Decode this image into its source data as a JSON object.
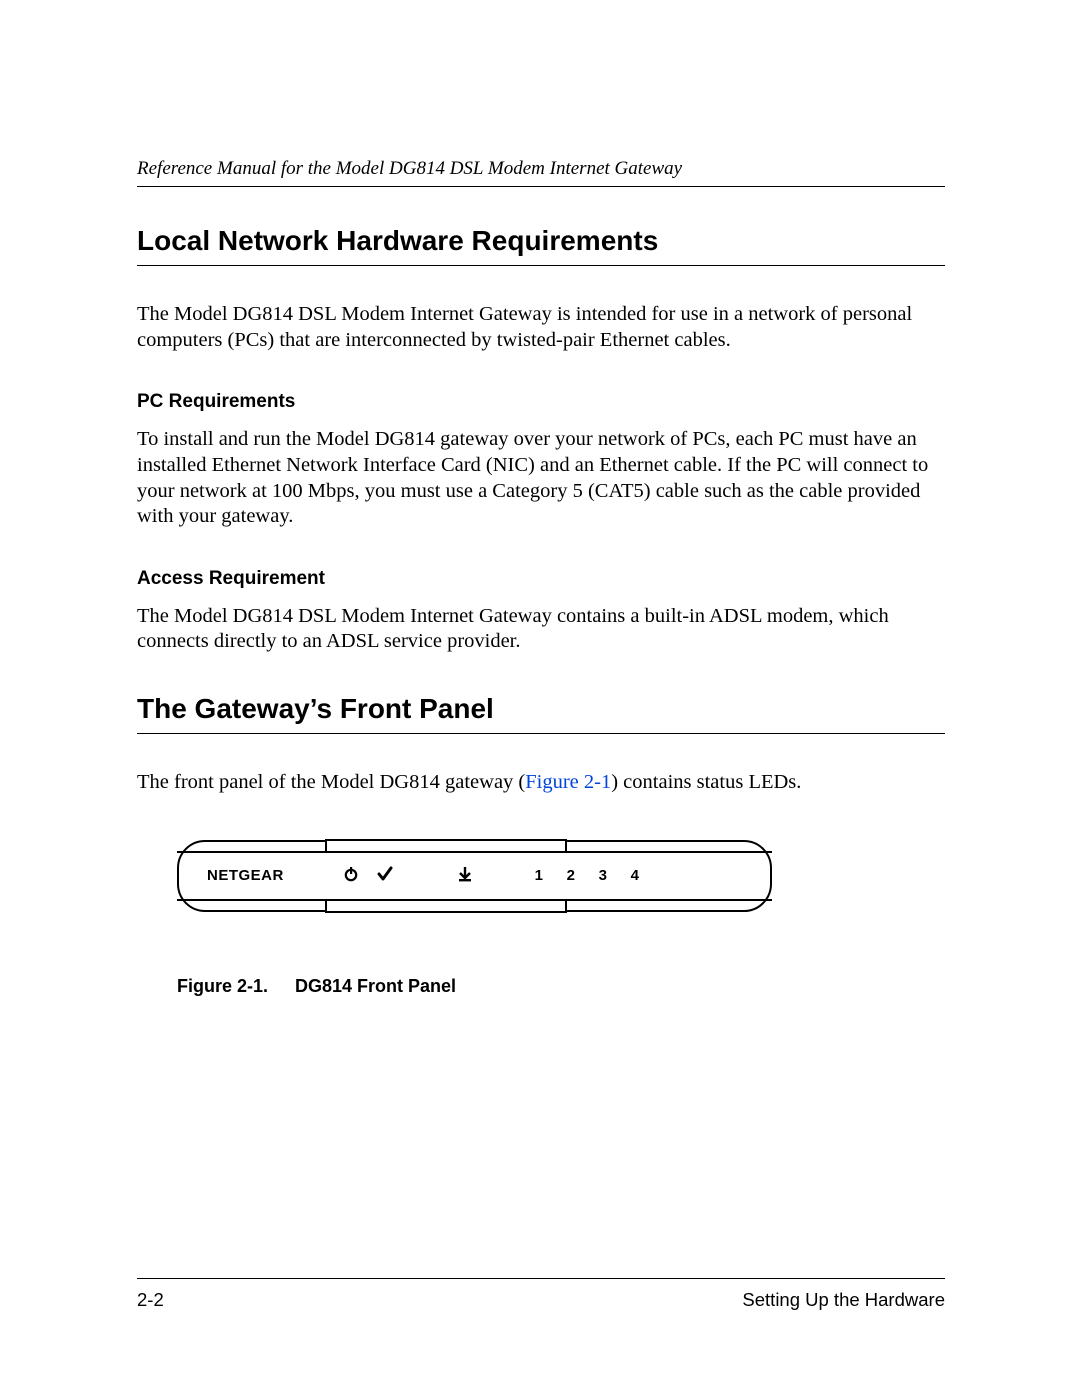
{
  "header": {
    "running_title": "Reference Manual for the Model DG814 DSL Modem Internet Gateway"
  },
  "sections": {
    "lnhr": {
      "title": "Local Network Hardware Requirements",
      "intro": "The Model DG814 DSL Modem Internet Gateway is intended for use in a network of personal computers (PCs) that are interconnected by twisted-pair Ethernet cables.",
      "pc_req": {
        "title": "PC Requirements",
        "body": "To install and run the Model DG814 gateway over your network of PCs, each PC must have an installed Ethernet Network Interface Card (NIC) and an Ethernet cable. If the PC will connect to your network at 100 Mbps, you must use a Category 5 (CAT5) cable such as the cable provided with your gateway."
      },
      "access_req": {
        "title": "Access Requirement",
        "body": "The Model DG814 DSL Modem Internet Gateway contains a built-in ADSL modem, which connects directly to an ADSL service provider."
      }
    },
    "front_panel": {
      "title": "The Gateway’s Front Panel",
      "intro_before": "The front panel of the Model DG814 gateway (",
      "intro_ref": "Figure 2-1",
      "intro_after": ") contains status LEDs."
    }
  },
  "figure": {
    "brand": "NETGEAR",
    "icons": {
      "power": "power-icon",
      "check": "check-icon",
      "dsl": "dsl-icon"
    },
    "ports": [
      "1",
      "2",
      "3",
      "4"
    ],
    "caption_num": "Figure 2-1.",
    "caption_title": "DG814 Front Panel"
  },
  "footer": {
    "page_num": "2-2",
    "section": "Setting Up the Hardware"
  }
}
